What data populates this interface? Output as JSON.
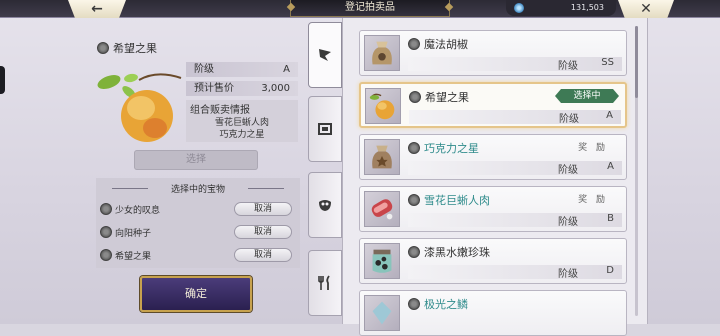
{
  "header": {
    "title": "登记拍卖品",
    "back_icon": "←",
    "close_icon": "✕",
    "currency_amount": "131,503"
  },
  "detail": {
    "name": "希望之果",
    "grade_label": "阶级",
    "grade_value": "A",
    "price_label": "预计售价",
    "price_value": "3,000",
    "combo_label": "组合贩卖情报",
    "combo_items": [
      "雪花巨蜥人肉",
      "巧克力之星"
    ],
    "select_label": "选择"
  },
  "chosen": {
    "title": "选择中的宝物",
    "items": [
      {
        "name": "少女的叹息",
        "cancel": "取消"
      },
      {
        "name": "向阳种子",
        "cancel": "取消"
      },
      {
        "name": "希望之果",
        "cancel": "取消"
      }
    ]
  },
  "confirm_label": "确定",
  "tabs": [
    {
      "icon": "pennant-icon"
    },
    {
      "icon": "frame-icon"
    },
    {
      "icon": "mask-icon"
    },
    {
      "icon": "utensils-icon"
    }
  ],
  "list": {
    "grade_label": "阶级",
    "selected_tag": "选择中",
    "reward_tag": "奖 励",
    "items": [
      {
        "name": "魔法胡椒",
        "grade": "SS",
        "teal": false,
        "tag": ""
      },
      {
        "name": "希望之果",
        "grade": "A",
        "teal": false,
        "tag": "selected"
      },
      {
        "name": "巧克力之星",
        "grade": "A",
        "teal": true,
        "tag": "reward"
      },
      {
        "name": "雪花巨蜥人肉",
        "grade": "B",
        "teal": true,
        "tag": "reward"
      },
      {
        "name": "漆黑水嫩珍珠",
        "grade": "D",
        "teal": false,
        "tag": ""
      },
      {
        "name": "极光之鳞",
        "grade": "",
        "teal": true,
        "tag": ""
      }
    ]
  },
  "colors": {
    "selected_border": "#e5c58a",
    "selected_tag": "#3e7a55",
    "teal_text": "#2e8b8b",
    "confirm_bg": "#2b2050"
  }
}
